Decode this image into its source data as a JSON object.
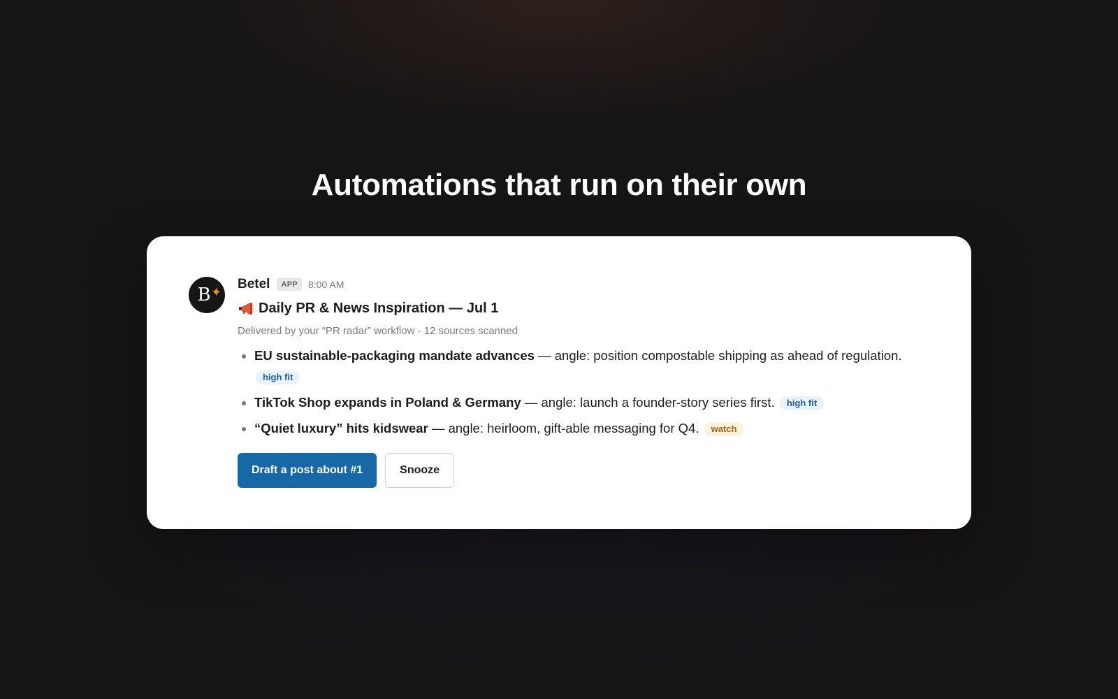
{
  "headline": "Automations that run on their own",
  "message": {
    "avatar": {
      "letter": "B",
      "spark": "✦",
      "spark_color": "#f08a24"
    },
    "sender": "Betel",
    "badge": "APP",
    "time": "8:00 AM",
    "title_icon": "megaphone-icon",
    "title": "Daily PR & News Inspiration — Jul 1",
    "subtitle": "Delivered by your “PR radar” workflow · 12 sources scanned",
    "items": [
      {
        "headline": "EU sustainable-packaging mandate advances",
        "angle": " — angle: position compostable shipping as ahead of regulation.",
        "tag": "high fit"
      },
      {
        "headline": "TikTok Shop expands in Poland & Germany",
        "angle": " — angle: launch a founder-story series first.",
        "tag": "high fit"
      },
      {
        "headline": "“Quiet luxury” hits kidswear",
        "angle": " — angle: heirloom, gift-able messaging for Q4.",
        "tag": "watch"
      }
    ],
    "actions": {
      "primary": "Draft a post about #1",
      "secondary": "Snooze"
    }
  },
  "colors": {
    "primary_button": "#1668a6",
    "tag_high_fit": "#1d5ea0",
    "tag_watch": "#a3631a",
    "background": "#161415"
  }
}
